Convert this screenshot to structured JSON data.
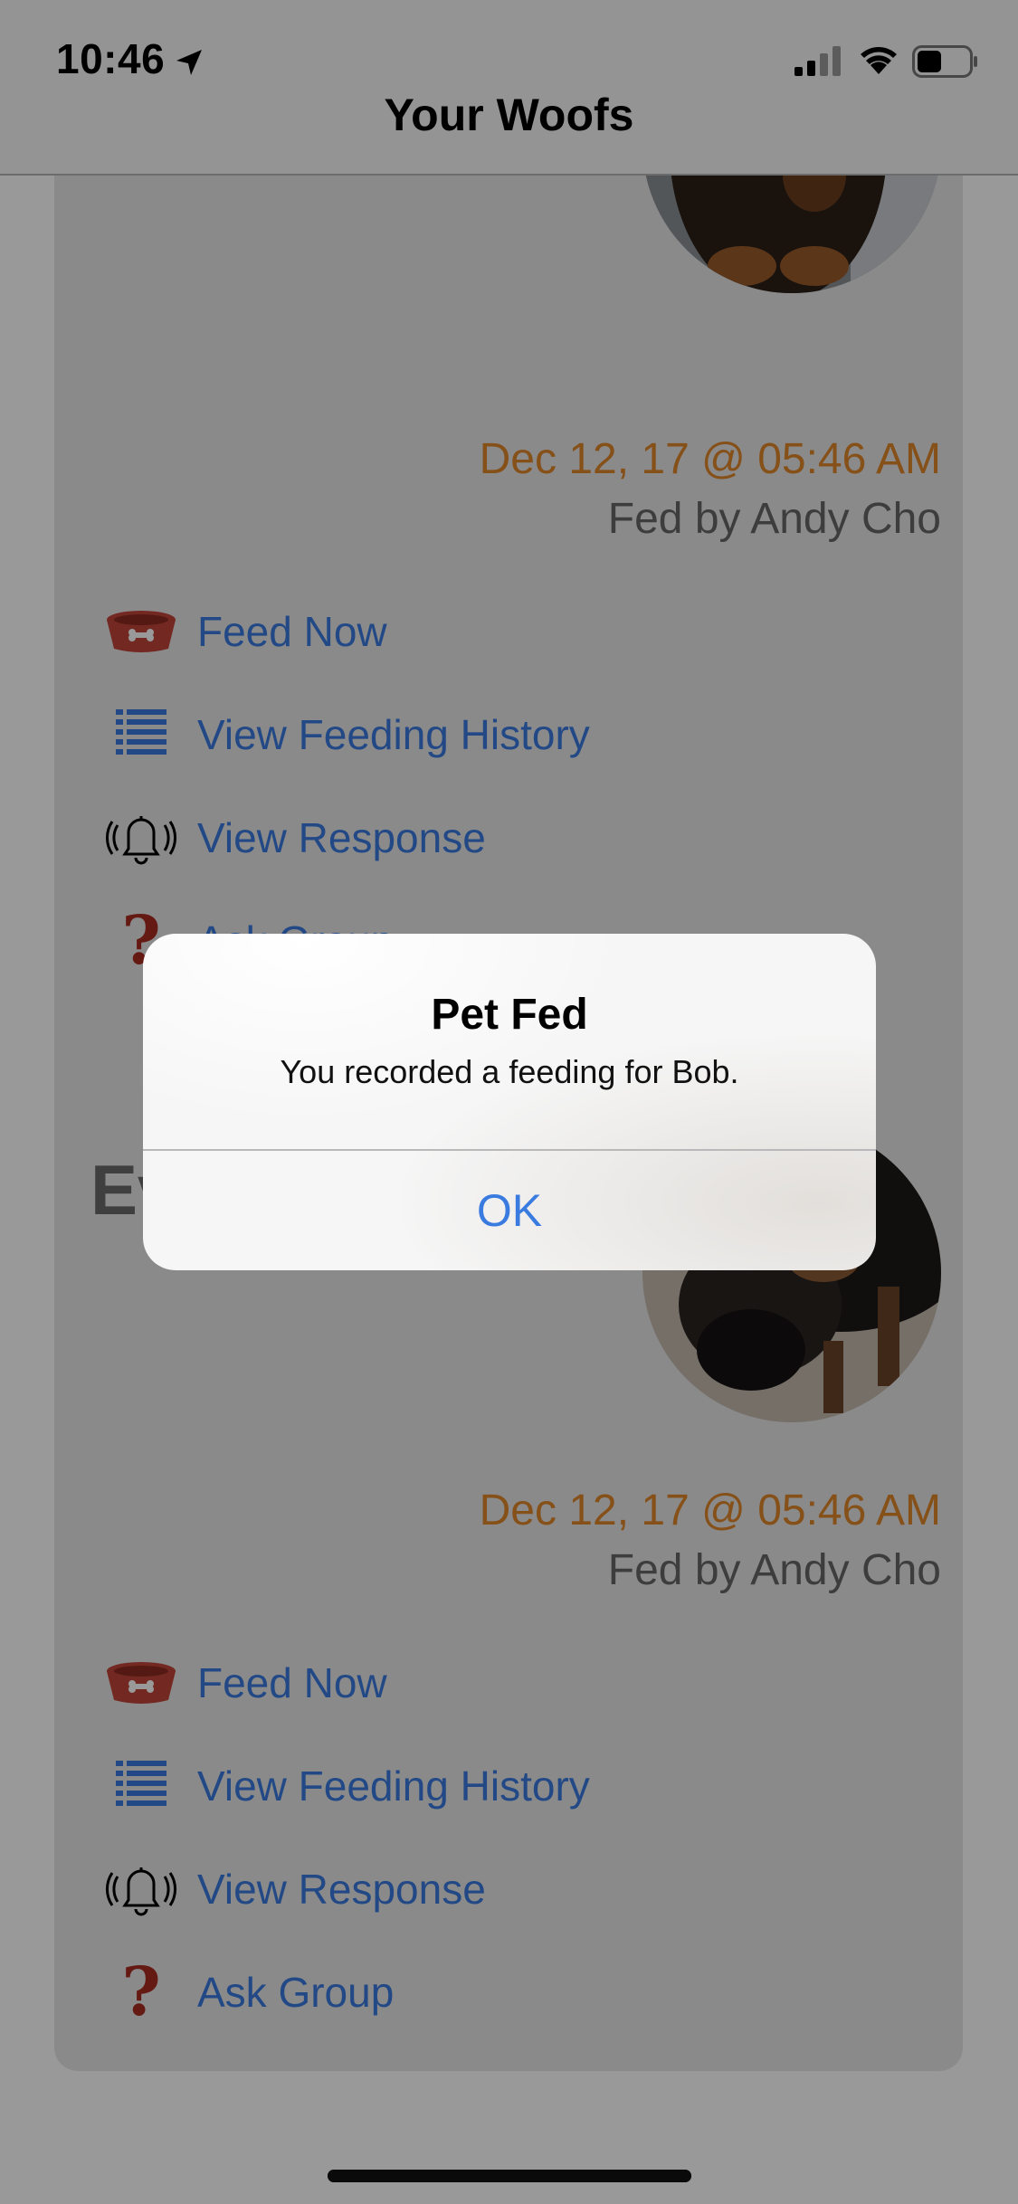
{
  "status_bar": {
    "time": "10:46"
  },
  "nav": {
    "title": "Your Woofs"
  },
  "pets": [
    {
      "name": "",
      "last_fed": "Dec 12, 17 @ 05:46 AM",
      "fed_by": "Fed by Andy Cho",
      "actions": {
        "feed": "Feed Now",
        "history": "View Feeding History",
        "response": "View Response",
        "ask": "Ask Group"
      }
    },
    {
      "name": "Ev",
      "last_fed": "Dec 12, 17 @ 05:46 AM",
      "fed_by": "Fed by Andy Cho",
      "actions": {
        "feed": "Feed Now",
        "history": "View Feeding History",
        "response": "View Response",
        "ask": "Ask Group"
      }
    }
  ],
  "alert": {
    "title": "Pet Fed",
    "message": "You recorded a feeding for Bob.",
    "ok_label": "OK"
  },
  "colors": {
    "accent": "#3a7be0",
    "timestamp": "#e0852a",
    "bowl": "#c0443a",
    "question": "#a82a20"
  },
  "icons": [
    "location-arrow-icon",
    "signal-icon",
    "wifi-icon",
    "battery-icon",
    "bowl-icon",
    "list-icon",
    "bell-icon",
    "question-icon"
  ]
}
